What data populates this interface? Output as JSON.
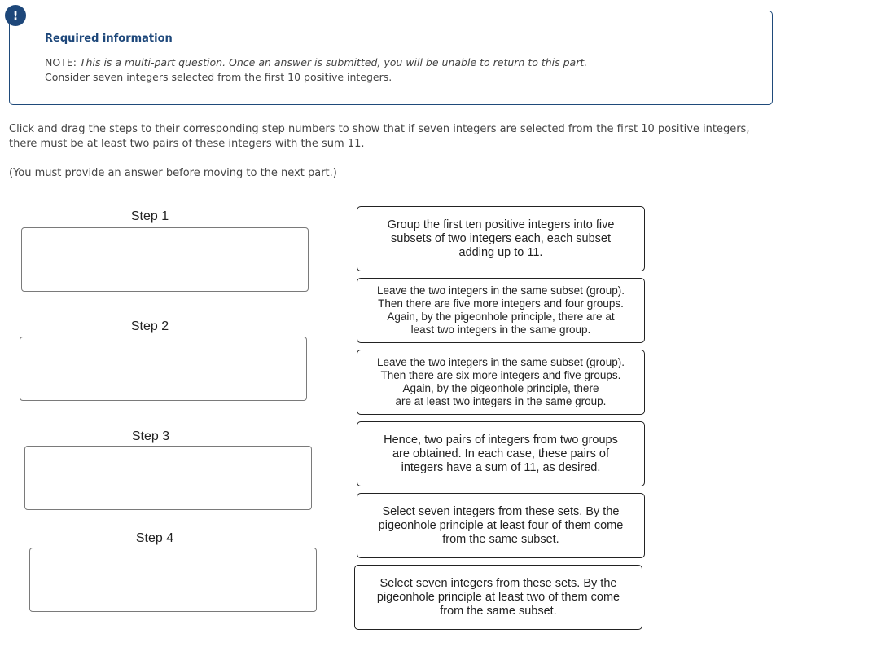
{
  "info_box": {
    "icon": "exclamation-icon",
    "icon_glyph": "!",
    "title": "Required information",
    "note_prefix": "NOTE: ",
    "note_italic": "This is a multi-part question. Once an answer is submitted, you will be unable to return to this part.",
    "context": "Consider seven integers selected from the first 10 positive integers."
  },
  "instructions": "Click and drag the steps to their corresponding step numbers to show that if seven integers are selected from the first 10 positive integers, there must be at least two pairs of these integers with the sum 11.",
  "must_answer": "(You must provide an answer before moving to the next part.)",
  "steps": [
    {
      "label": "Step 1",
      "value": ""
    },
    {
      "label": "Step 2",
      "value": ""
    },
    {
      "label": "Step 3",
      "value": ""
    },
    {
      "label": "Step 4",
      "value": ""
    }
  ],
  "cards": [
    {
      "lines": [
        "Group the first ten positive integers into five",
        "subsets of two integers each, each subset",
        "adding up to 11."
      ]
    },
    {
      "lines": [
        "Leave the two integers in the same subset (group).",
        "Then there are five more integers and four groups.",
        "Again, by the pigeonhole principle, there are at",
        "least two integers in the same group."
      ]
    },
    {
      "lines": [
        "Leave the two integers in the same subset (group).",
        "Then there are six more integers and five groups.",
        "Again, by the pigeonhole principle, there",
        "are at least two integers in the same group."
      ]
    },
    {
      "lines": [
        "Hence, two pairs of integers from two groups",
        "are obtained. In each case, these pairs of",
        "integers have a sum of 11, as desired."
      ]
    },
    {
      "lines": [
        "Select seven integers from these sets. By the",
        "pigeonhole principle at least four of them come",
        "from the same subset."
      ]
    },
    {
      "lines": [
        "Select seven integers from these sets. By the",
        "pigeonhole principle at least two of them come",
        "from the same subset."
      ]
    }
  ],
  "colors": {
    "accent": "#1d477a",
    "text": "#444444",
    "card_border": "#222222",
    "drop_border": "#7a7a7a"
  }
}
